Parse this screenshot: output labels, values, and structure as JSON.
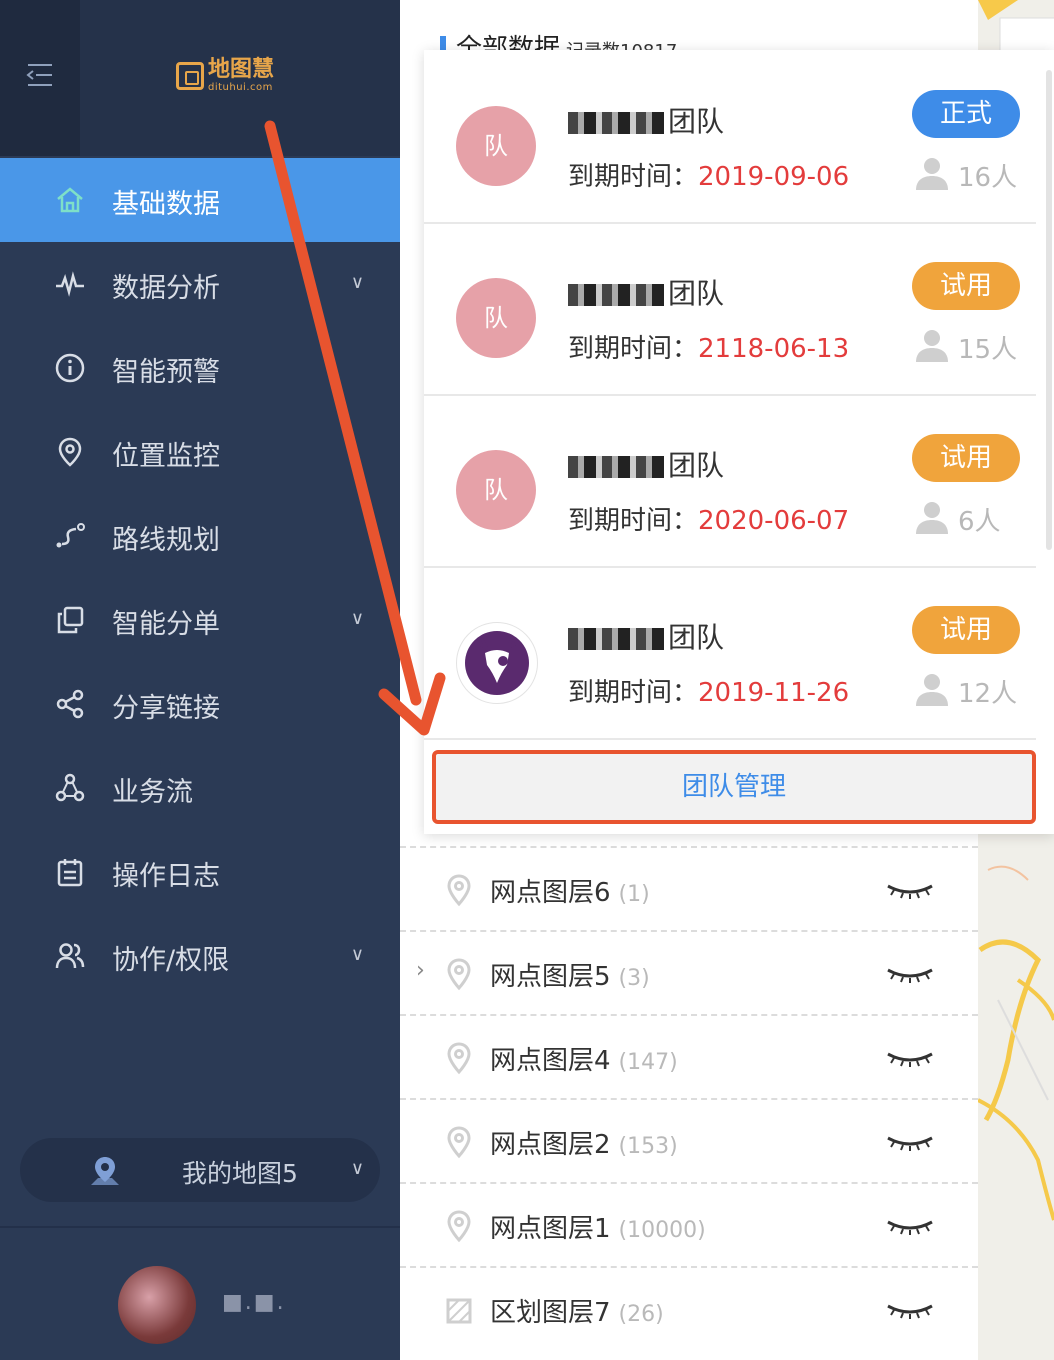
{
  "app": {
    "logo_cn": "地图慧",
    "logo_en": "dituhui.com"
  },
  "nav": {
    "items": [
      {
        "label": "基础数据",
        "icon": "home-icon",
        "active": true,
        "chevron": false
      },
      {
        "label": "数据分析",
        "icon": "pulse-icon",
        "chevron": true
      },
      {
        "label": "智能预警",
        "icon": "info-circle-icon",
        "chevron": false
      },
      {
        "label": "位置监控",
        "icon": "location-pin-icon",
        "chevron": false
      },
      {
        "label": "路线规划",
        "icon": "route-icon",
        "chevron": false
      },
      {
        "label": "智能分单",
        "icon": "copy-icon",
        "chevron": true
      },
      {
        "label": "分享链接",
        "icon": "share-icon",
        "chevron": false
      },
      {
        "label": "业务流",
        "icon": "workflow-icon",
        "chevron": false
      },
      {
        "label": "操作日志",
        "icon": "calendar-log-icon",
        "chevron": false
      },
      {
        "label": "协作/权限",
        "icon": "users-icon",
        "chevron": true
      }
    ],
    "chevron_glyph": "∨"
  },
  "map_selector": {
    "label": "我的地图5",
    "chevron": "∨"
  },
  "user": {
    "name": "■.■."
  },
  "content": {
    "title": "全部数据",
    "record_count": "记录数10817"
  },
  "teams": [
    {
      "avatar": "队",
      "name_suffix": "团队",
      "expire_label": "到期时间：",
      "expire_date": "2019-09-06",
      "tag": "正式",
      "tag_type": "formal",
      "members": "16人"
    },
    {
      "avatar": "队",
      "name_suffix": "团队",
      "expire_label": "到期时间：",
      "expire_date": "2118-06-13",
      "tag": "试用",
      "tag_type": "trial",
      "members": "15人"
    },
    {
      "avatar": "队",
      "name_suffix": "团队",
      "expire_label": "到期时间：",
      "expire_date": "2020-06-07",
      "tag": "试用",
      "tag_type": "trial",
      "members": "6人"
    },
    {
      "avatar": "",
      "name_suffix": "团队",
      "expire_label": "到期时间：",
      "expire_date": "2019-11-26",
      "tag": "试用",
      "tag_type": "trial",
      "members": "12人"
    }
  ],
  "team_manage_label": "团队管理",
  "layers": [
    {
      "name": "网点图层6",
      "count": "(1)",
      "icon": "location-pin-icon",
      "expanded_chevron": false
    },
    {
      "name": "网点图层5",
      "count": "(3)",
      "icon": "location-pin-icon",
      "expanded_chevron": true
    },
    {
      "name": "网点图层4",
      "count": "(147)",
      "icon": "location-pin-icon",
      "expanded_chevron": false
    },
    {
      "name": "网点图层2",
      "count": "(153)",
      "icon": "location-pin-icon",
      "expanded_chevron": false
    },
    {
      "name": "网点图层1",
      "count": "(10000)",
      "icon": "location-pin-icon",
      "expanded_chevron": false
    },
    {
      "name": "区划图层7",
      "count": "(26)",
      "icon": "region-icon",
      "expanded_chevron": false
    }
  ],
  "colors": {
    "sidebar_bg": "#2b3a55",
    "active_bg": "#4a97e8",
    "accent_blue": "#3e8ce8",
    "trial_orange": "#f0a43c",
    "date_red": "#e33c3c",
    "annotation_red": "#e8542f"
  }
}
